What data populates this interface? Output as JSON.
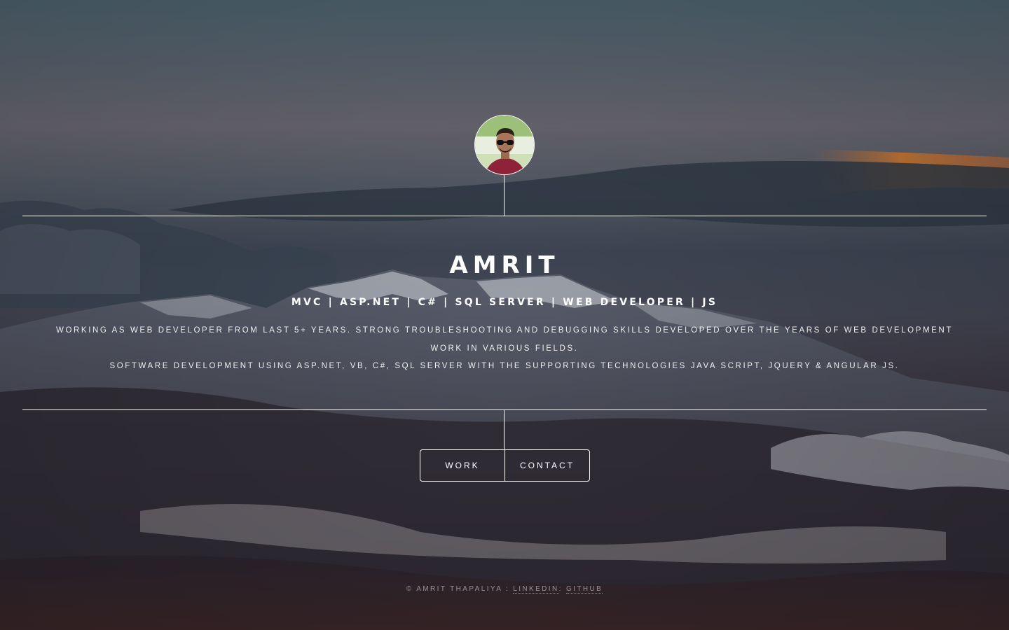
{
  "avatar": {
    "alt": "Amrit Thapaliya profile photo"
  },
  "header": {
    "name": "AMRIT",
    "skills": "MVC | ASP.NET | C# | SQL SERVER | WEB DEVELOPER | JS",
    "description_line1": "Working as web developer from last 5+ years. Strong troubleshooting and debugging skills developed over the years of web development work in various fields.",
    "description_line2": "Software development using ASP.NET, VB, C#, SQL Server with the supporting technologies Java Script, jQuery & Angular JS."
  },
  "nav": {
    "items": [
      {
        "label": "WORK"
      },
      {
        "label": "CONTACT"
      }
    ]
  },
  "footer": {
    "copyright": "© Amrit Thapaliya : ",
    "linkedin": "LinkedIn",
    "separator": ": ",
    "github": "Github"
  }
}
